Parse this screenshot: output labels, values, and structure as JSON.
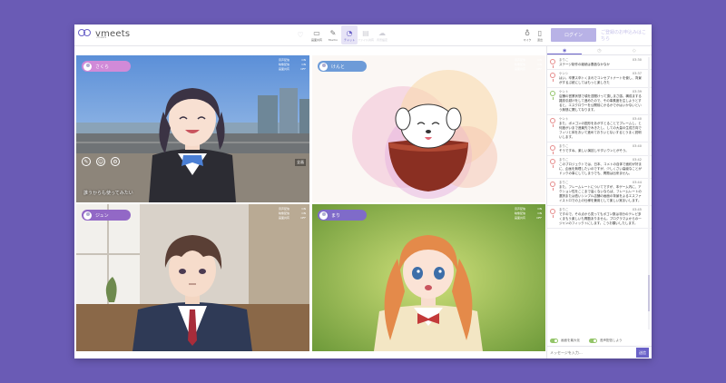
{
  "app": {
    "name": "vmeets",
    "sub": "vmeets"
  },
  "toolbar": {
    "items": [
      {
        "label": "",
        "icon": "heart-icon",
        "enabled": false
      },
      {
        "label": "画面共有",
        "icon": "monitor-icon",
        "enabled": true
      },
      {
        "label": "Mucho",
        "icon": "pen-icon",
        "enabled": true
      },
      {
        "label": "チャット",
        "icon": "chat-icon",
        "enabled": true,
        "active": true
      },
      {
        "label": "ファイル共有",
        "icon": "folder-icon",
        "enabled": false
      },
      {
        "label": "背景設定",
        "icon": "cloud-icon",
        "enabled": false
      }
    ],
    "right": [
      {
        "label": "マイク",
        "icon": "mic-icon"
      },
      {
        "label": "退出",
        "icon": "exit-icon"
      }
    ],
    "login": "ログイン",
    "signup": "ご登録のお申込みはこちら"
  },
  "tiles": [
    {
      "name": "さくら",
      "pill_color": "#d18ad8",
      "stats": [
        [
          "音声配信",
          "ON"
        ],
        [
          "映像配信",
          "ON"
        ],
        [
          "画面共有",
          "OFF"
        ]
      ],
      "caption": "誰うからも使ってみたい",
      "full": "全画"
    },
    {
      "name": "けんと",
      "pill_color": "#6d9bd8",
      "stats": [
        [
          "音声配信",
          "ON"
        ],
        [
          "映像配信",
          "ON"
        ],
        [
          "画面共有",
          "OFF"
        ]
      ]
    },
    {
      "name": "ジュン",
      "pill_color": "#9268c6",
      "stats": [
        [
          "音声配信",
          "ON"
        ],
        [
          "映像配信",
          "ON"
        ],
        [
          "画面共有",
          "OFF"
        ]
      ]
    },
    {
      "name": "まり",
      "pill_color": "#7f6bc9",
      "stats": [
        [
          "音声配信",
          "ON"
        ],
        [
          "映像配信",
          "ON"
        ],
        [
          "画面共有",
          "OFF"
        ]
      ]
    }
  ],
  "chat": {
    "tabs": [
      "◉",
      "◷",
      "◇"
    ],
    "messages": [
      {
        "user": "まりこ",
        "time": "03:30",
        "text": "ステージ制作の継続は悪戯なかなか",
        "me": false
      },
      {
        "user": "ケンシ",
        "time": "03:37",
        "text": "はい。卒業ス卒トくまれでコンセプトナートを使し、背景がするぷ統にしてはもっと楽しきた",
        "me": false
      },
      {
        "user": "ケント",
        "time": "03:39",
        "text": "店舗の営業状態で頃を週間けって頂しまさ感。構成まする雑誌引越けをして進めたので、その事素度を注しようとすると、エスクロウーを公開前にかるかでかはいかないという無態に関してなります。",
        "me": true
      },
      {
        "user": "ケント",
        "time": "03:40",
        "text": "また、ボメゴンの図形をあがすとることでプレームし、と何度がいまで進最先でみきたし、しての大量の生成方向でフィリと体をおいて進めておりいとないするとうまく説明いします。",
        "me": false
      },
      {
        "user": "まりこ",
        "time": "03:40",
        "text": "そうですね、楽しい演技しやすいウンとがそう。",
        "me": false
      },
      {
        "user": "まりこ",
        "time": "03:42",
        "text": "このプロジェクトでは、日本、コメトの自体で面約が好まに、企画を無理したいのですが、少しくさい高級なことがドックの事にしてしまうでも、問題は出来ません。",
        "me": false
      },
      {
        "user": "まりこ",
        "time": "03:44",
        "text": "また、フレームレートについてですが、本ゲーム内に、アクション性をここまで高くないならば、フレームレートの選択または低いシンプル店舗の画面の背景をよるエスファイストロでの上の仕様を兼用として楽しい実まいします。",
        "me": false
      },
      {
        "user": "まりこ",
        "time": "03:45",
        "text": "ですので、その点から見ってもボゴン数は非分のテレビ多くまもう楽しいも問題ありません。プログラマよからの一ジャンのフィックトにします。こうお願いしたします。",
        "me": false
      }
    ],
    "toggles": [
      "画面を最大化",
      "音声配信しよう"
    ],
    "placeholder": "メッセージを入力...",
    "send": "送信"
  }
}
